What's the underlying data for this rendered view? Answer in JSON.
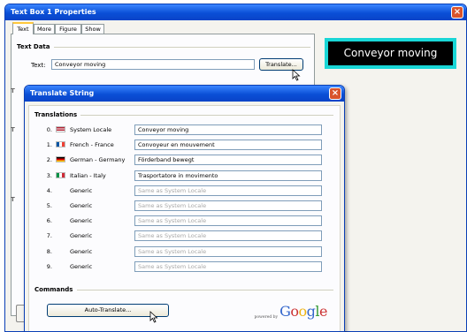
{
  "main_window": {
    "title": "Text Box 1 Properties",
    "close_glyph": "×",
    "tabs": [
      "Text",
      "More",
      "Figure",
      "Show"
    ],
    "text_data_heading": "Text Data",
    "text_label": "Text:",
    "text_value": "Conveyor moving",
    "translate_button": "Translate...",
    "preview_text": "Conveyor moving",
    "side_marks": [
      "T",
      "T",
      "T"
    ]
  },
  "translate_dialog": {
    "title": "Translate String",
    "close_glyph": "×",
    "translations_heading": "Translations",
    "rows": [
      {
        "index": "0.",
        "flag": "us-flag",
        "locale": "System Locale",
        "value": "Conveyor moving",
        "placeholder": false
      },
      {
        "index": "1.",
        "flag": "france-flag",
        "locale": "French - France",
        "value": "Convoyeur en mouvement",
        "placeholder": false
      },
      {
        "index": "2.",
        "flag": "germany-flag",
        "locale": "German - Germany",
        "value": "Förderband bewegt",
        "placeholder": false
      },
      {
        "index": "3.",
        "flag": "italy-flag",
        "locale": "Italian - Italy",
        "value": "Trasportatore in movimento",
        "placeholder": false
      },
      {
        "index": "4.",
        "flag": "blank-flag",
        "locale": "Generic",
        "value": "Same as System Locale",
        "placeholder": true
      },
      {
        "index": "5.",
        "flag": "blank-flag",
        "locale": "Generic",
        "value": "Same as System Locale",
        "placeholder": true
      },
      {
        "index": "6.",
        "flag": "blank-flag",
        "locale": "Generic",
        "value": "Same as System Locale",
        "placeholder": true
      },
      {
        "index": "7.",
        "flag": "blank-flag",
        "locale": "Generic",
        "value": "Same as System Locale",
        "placeholder": true
      },
      {
        "index": "8.",
        "flag": "blank-flag",
        "locale": "Generic",
        "value": "Same as System Locale",
        "placeholder": true
      },
      {
        "index": "9.",
        "flag": "blank-flag",
        "locale": "Generic",
        "value": "Same as System Locale",
        "placeholder": true
      }
    ],
    "commands_heading": "Commands",
    "auto_translate_button": "Auto-Translate...",
    "powered_by": "powered by",
    "google_logo": "Google"
  },
  "colors": {
    "title_bar": "#0a4fd6",
    "preview_border": "#19d6d6",
    "preview_bg": "#000000",
    "close_button": "#d9532c"
  }
}
